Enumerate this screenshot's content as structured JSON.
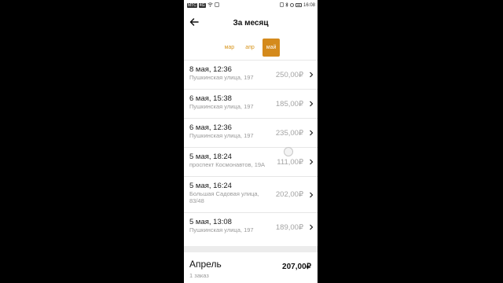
{
  "statusbar": {
    "left_badges": [
      "МТС",
      "4G"
    ],
    "time": "16:08"
  },
  "header": {
    "title": "За месяц"
  },
  "months": [
    {
      "label": "мар",
      "active": false
    },
    {
      "label": "апр",
      "active": false
    },
    {
      "label": "май",
      "active": true
    }
  ],
  "orders": [
    {
      "date": "8 мая, 12:36",
      "address": "Пушкинская улица, 197",
      "price": "250,00₽"
    },
    {
      "date": "6 мая, 15:38",
      "address": "Пушкинская улица, 197",
      "price": "185,00₽"
    },
    {
      "date": "6 мая, 12:36",
      "address": "Пушкинская улица, 197",
      "price": "235,00₽"
    },
    {
      "date": "5 мая, 18:24",
      "address": "проспект Космонавтов, 19А",
      "price": "111,00₽"
    },
    {
      "date": "5 мая, 16:24",
      "address": "Большая Садовая улица, 83/48",
      "price": "202,00₽"
    },
    {
      "date": "5 мая, 13:08",
      "address": "Пушкинская улица, 197",
      "price": "189,00₽"
    }
  ],
  "summary": {
    "month": "Апрель",
    "count": "1 заказ",
    "total": "207,00₽"
  },
  "colors": {
    "accent": "#d48a1c",
    "price_gray": "#a4a4a4"
  }
}
